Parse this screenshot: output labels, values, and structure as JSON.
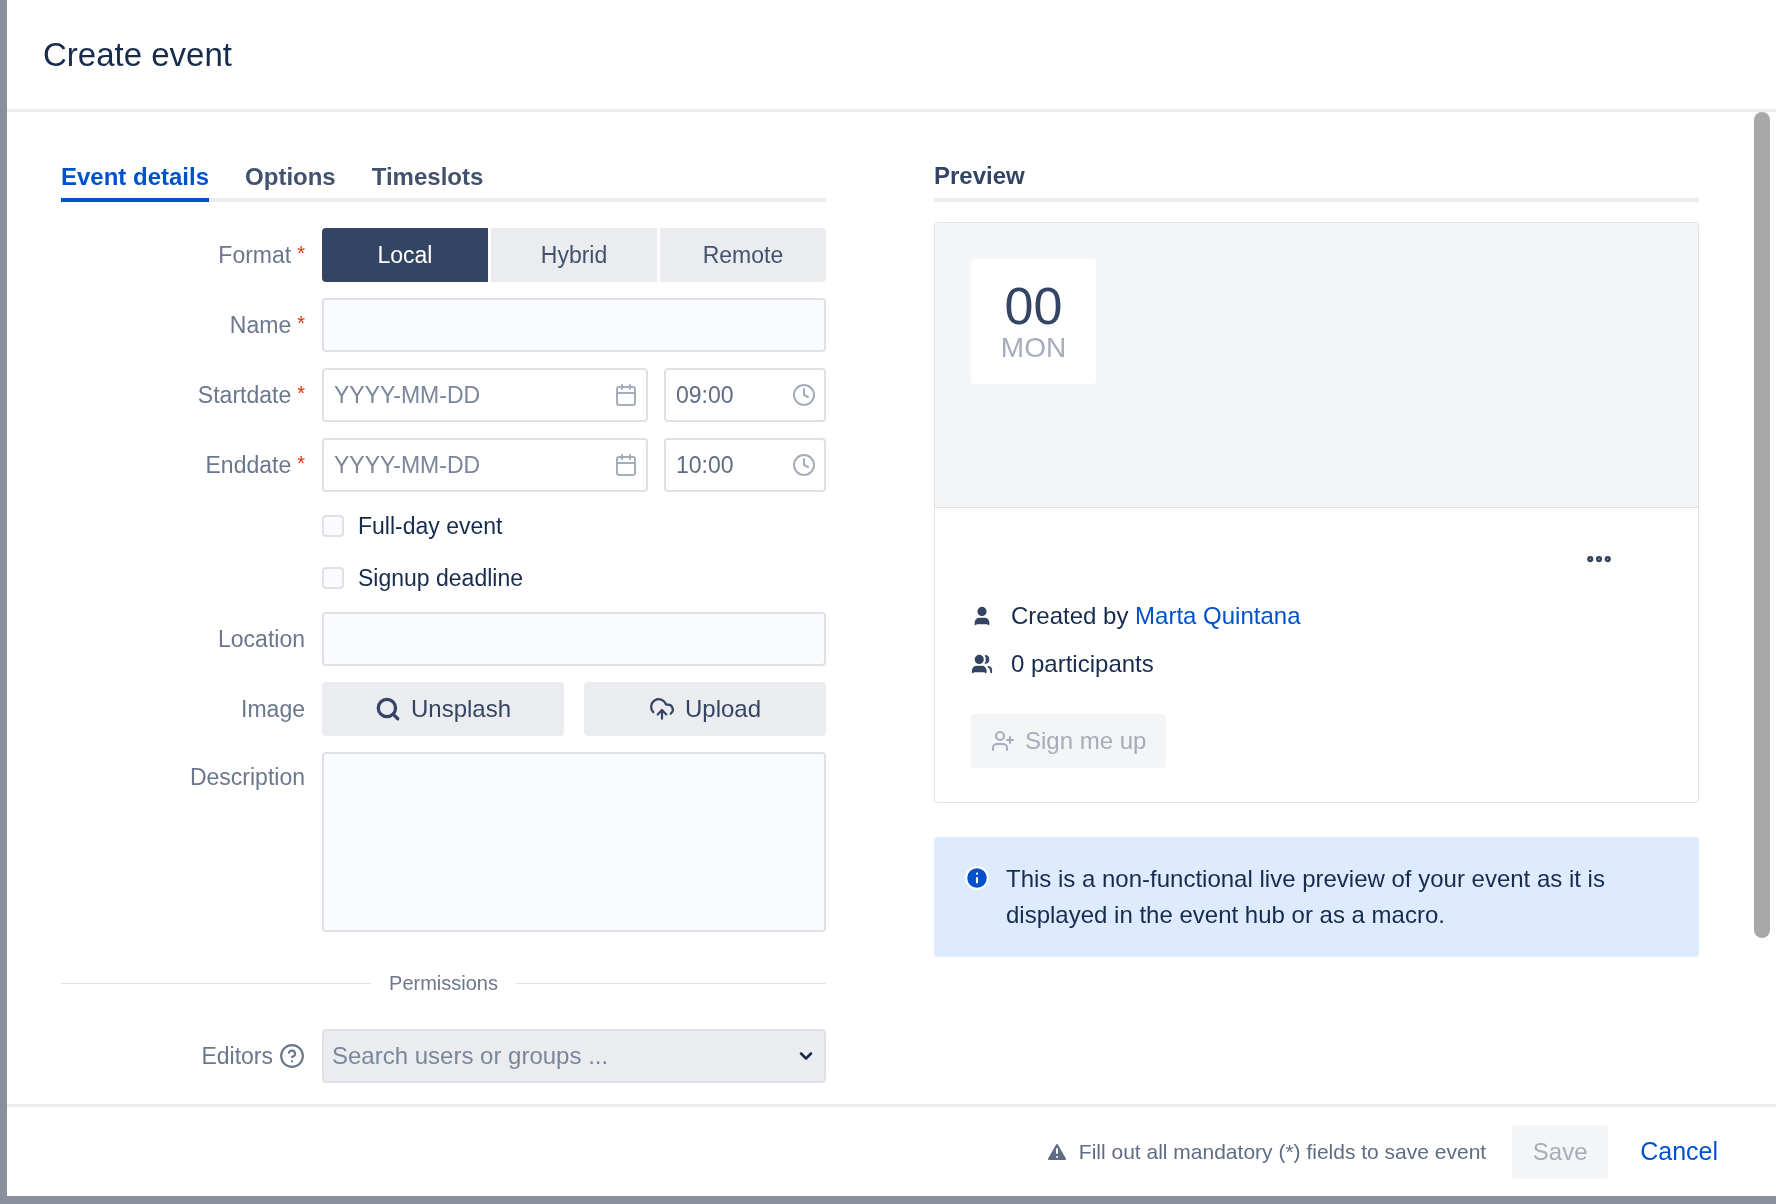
{
  "dialog": {
    "title": "Create event"
  },
  "tabs": [
    {
      "label": "Event details",
      "selected": true
    },
    {
      "label": "Options",
      "selected": false
    },
    {
      "label": "Timeslots",
      "selected": false
    }
  ],
  "form": {
    "format": {
      "label": "Format",
      "required_mark": "*",
      "options": [
        {
          "label": "Local",
          "selected": true
        },
        {
          "label": "Hybrid",
          "selected": false
        },
        {
          "label": "Remote",
          "selected": false
        }
      ]
    },
    "name": {
      "label": "Name",
      "required_mark": "*"
    },
    "startdate": {
      "label": "Startdate",
      "required_mark": "*",
      "date_placeholder": "YYYY-MM-DD",
      "time_value": "09:00"
    },
    "enddate": {
      "label": "Enddate",
      "required_mark": "*",
      "date_placeholder": "YYYY-MM-DD",
      "time_value": "10:00"
    },
    "checkboxes": [
      {
        "label": "Full-day event",
        "checked": false
      },
      {
        "label": "Signup deadline",
        "checked": false
      }
    ],
    "location": {
      "label": "Location"
    },
    "image": {
      "label": "Image",
      "buttons": [
        {
          "kind": "search",
          "label": "Unsplash"
        },
        {
          "kind": "upload",
          "label": "Upload"
        }
      ]
    },
    "description": {
      "label": "Description"
    },
    "permissions_heading": "Permissions",
    "editors": {
      "label": "Editors",
      "placeholder": "Search users or groups ..."
    }
  },
  "preview": {
    "heading": "Preview",
    "day": "00",
    "weekday": "MON",
    "created_by": "Created by",
    "creator": "Marta Quintana",
    "participants": "0 participants",
    "signup_button": {
      "label": "Sign me up",
      "disabled": true
    },
    "info": "This is a non-functional live preview of your event as it is displayed in the event hub or as a macro."
  },
  "footer": {
    "warning": "Fill out all mandatory (*) fields to save event",
    "save": {
      "label": "Save",
      "disabled": true
    },
    "cancel": "Cancel"
  }
}
